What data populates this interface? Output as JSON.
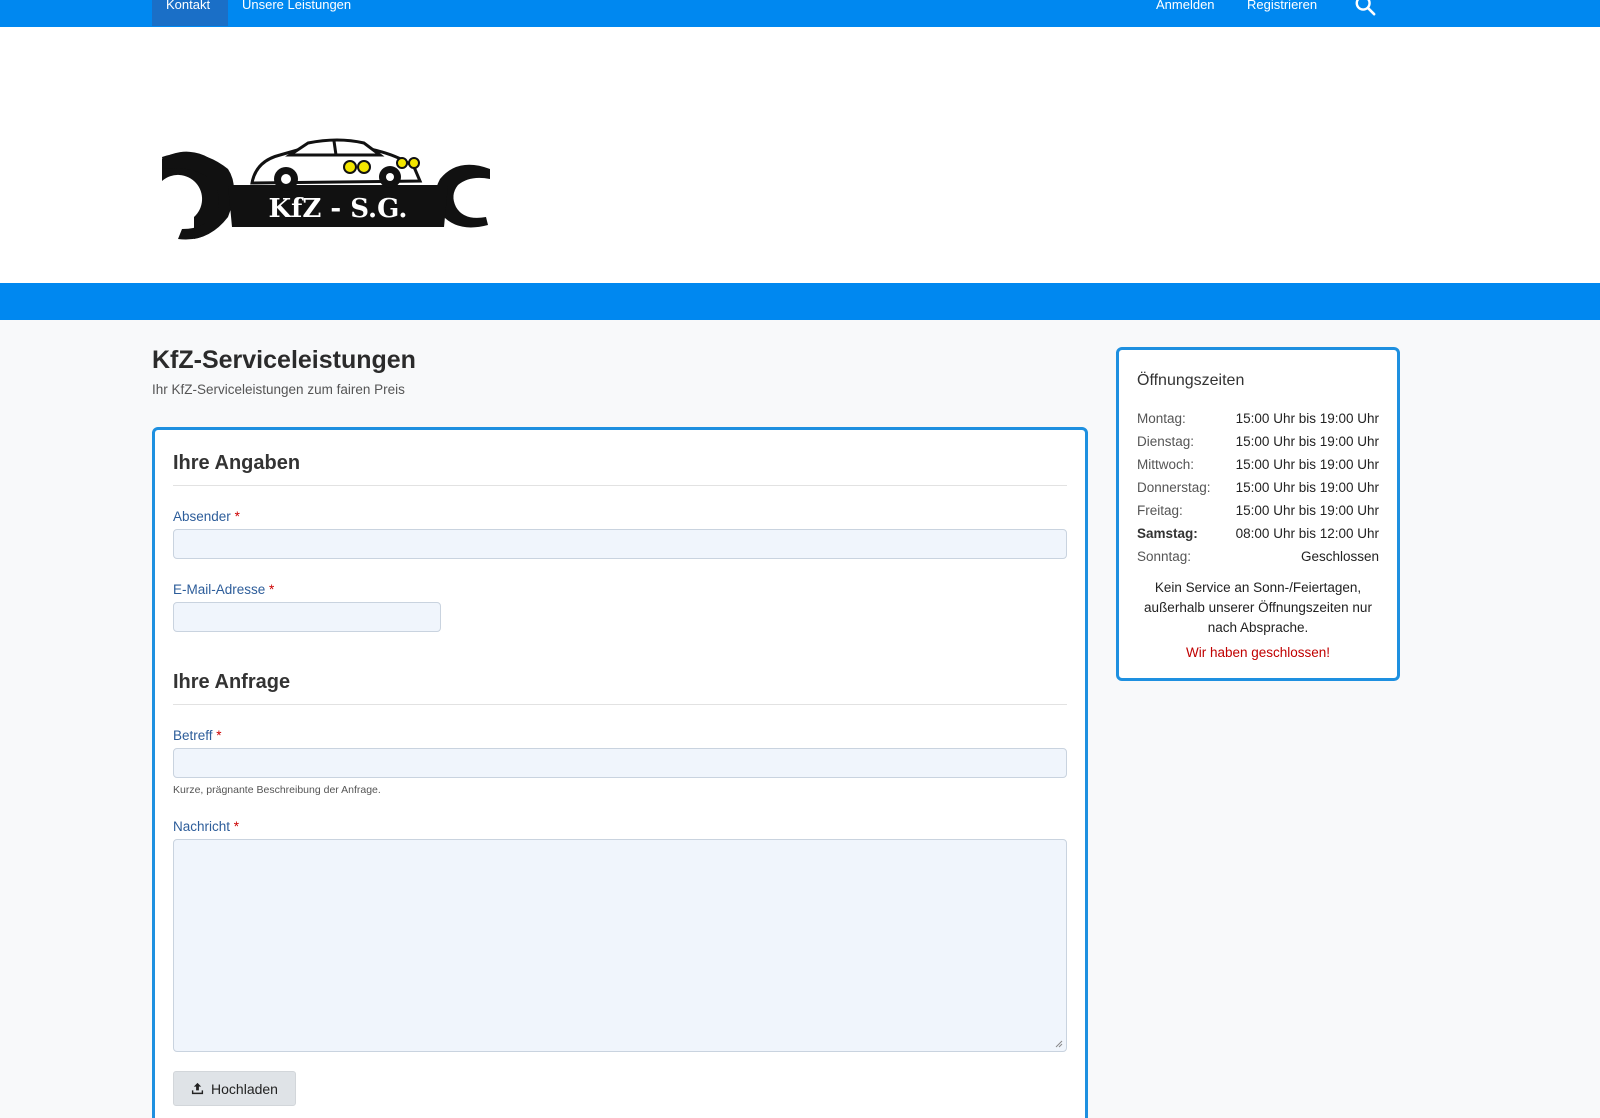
{
  "nav": {
    "kontakt": "Kontakt",
    "leistungen": "Unsere Leistungen",
    "anmelden": "Anmelden",
    "registrieren": "Registrieren",
    "search_icon": "search-icon"
  },
  "brand": {
    "logo_text": "KfZ - S.G.",
    "primary_color": "#0088f0",
    "card_border_color": "#1e90e0"
  },
  "page": {
    "title": "KfZ-Serviceleistungen",
    "subtitle": "Ihr KfZ-Serviceleistungen zum fairen Preis"
  },
  "form": {
    "section1_title": "Ihre Angaben",
    "absender_label": "Absender",
    "absender_value": "",
    "email_label": "E-Mail-Adresse",
    "email_value": "",
    "section2_title": "Ihre Anfrage",
    "betreff_label": "Betreff",
    "betreff_value": "",
    "betreff_help": "Kurze, prägnante Beschreibung der Anfrage.",
    "nachricht_label": "Nachricht",
    "nachricht_value": "",
    "required_mark": "*",
    "upload_label": "Hochladen",
    "upload_icon": "upload-icon"
  },
  "hours": {
    "title": "Öffnungszeiten",
    "rows": [
      {
        "day": "Montag:",
        "time": "15:00 Uhr bis 19:00 Uhr"
      },
      {
        "day": "Dienstag:",
        "time": "15:00 Uhr bis 19:00 Uhr"
      },
      {
        "day": "Mittwoch:",
        "time": "15:00 Uhr bis 19:00 Uhr"
      },
      {
        "day": "Donnerstag:",
        "time": "15:00 Uhr bis 19:00 Uhr"
      },
      {
        "day": "Freitag:",
        "time": "15:00 Uhr bis 19:00 Uhr"
      },
      {
        "day": "Samstag:",
        "time": "08:00 Uhr bis 12:00 Uhr"
      },
      {
        "day": "Sonntag:",
        "time": "Geschlossen"
      }
    ],
    "note": "Kein Service an Sonn-/Feiertagen, außerhalb unserer Öffnungszeiten nur nach Absprache.",
    "status": "Wir haben geschlossen!",
    "status_color": "#c00000"
  }
}
